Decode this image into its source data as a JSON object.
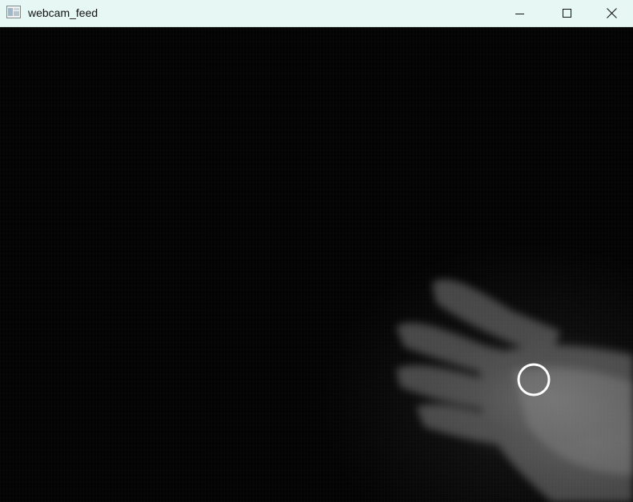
{
  "window": {
    "title": "webcam_feed",
    "controls": {
      "minimize_icon": "minimize-icon",
      "maximize_icon": "maximize-icon",
      "close_icon": "close-icon"
    }
  },
  "feed": {
    "icon": "app-window-icon",
    "tracking_marker": "circle",
    "marker_color": "#ffffff",
    "background_color": "#030303",
    "titlebar_color": "#e6f7f4"
  }
}
